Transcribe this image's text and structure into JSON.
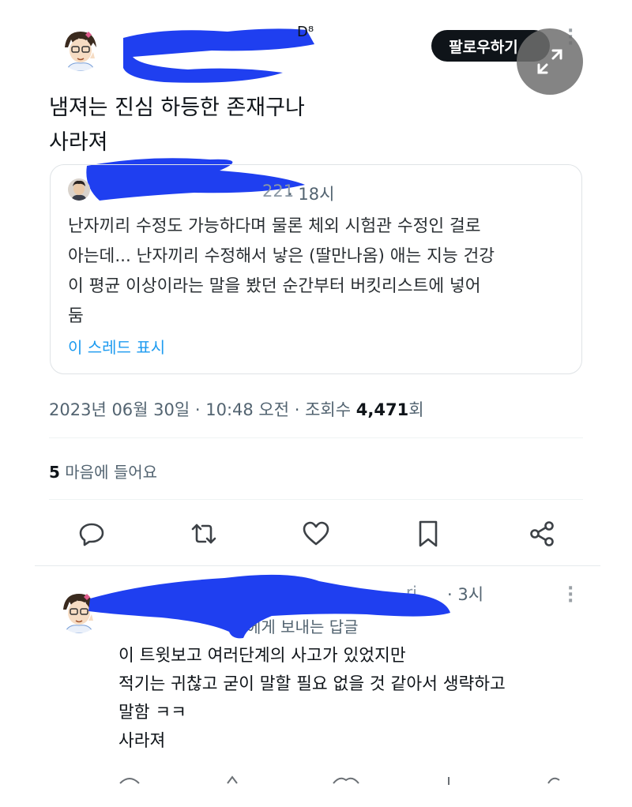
{
  "tweet": {
    "follow_label": "팔로우하기",
    "text_lines": [
      "냄져는 진심 하등한 존재구나",
      "사라져"
    ],
    "quote": {
      "time": "· 18시",
      "lines": [
        "난자끼리 수정도 가능하다며 물론 체외 시험관 수정인 걸로",
        "아는데... 난자끼리 수정해서 낳은 (딸만나옴) 애는 지능 건강",
        "이 평균 이상이라는 말을 봤던 순간부터 버킷리스트에 넣어",
        "둠"
      ],
      "show_thread": "이 스레드 표시"
    },
    "meta": {
      "date": "2023년 06월 30일",
      "sep1": " · ",
      "time": "10:48 오전",
      "sep2": " · ",
      "views_label": "조회수 ",
      "views_count": "4,471",
      "views_unit": "회"
    },
    "likes": {
      "count": "5",
      "label": " 마음에 들어요"
    }
  },
  "reply": {
    "time": "· 3시",
    "replying_to": "에게 보내는 답글",
    "lines": [
      "이 트윗보고 여러단계의 사고가 있었지만",
      "적기는 귀찮고 굳이 말할 필요 없을 것 같아서 생략하고",
      "말함 ㅋㅋ",
      "사라져"
    ]
  },
  "icons": [
    "reply-icon",
    "retweet-icon",
    "like-icon",
    "bookmark-icon",
    "share-icon",
    "expand-icon",
    "more-icon"
  ],
  "colors": {
    "accent": "#1d9bf0",
    "redaction": "#1f3ff0",
    "text": "#0f1419",
    "muted": "#536471"
  }
}
